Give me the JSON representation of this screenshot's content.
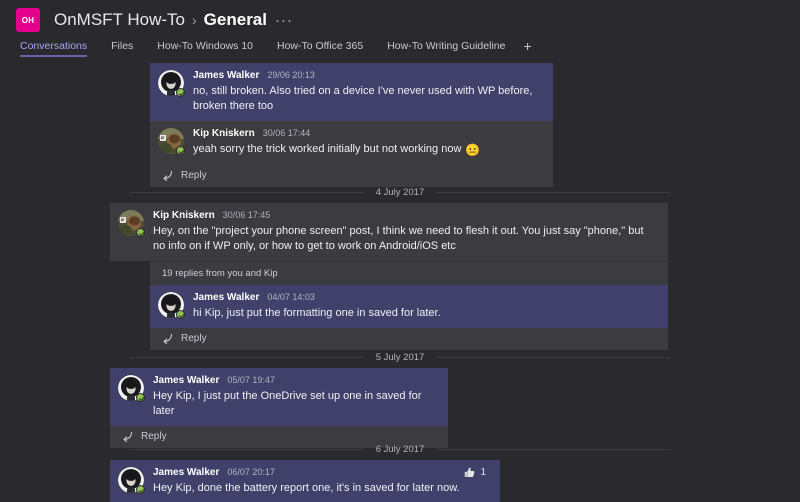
{
  "header": {
    "team_avatar_initials": "OH",
    "team_name": "OnMSFT How-To",
    "separator": "›",
    "channel_name": "General",
    "more_options": "···"
  },
  "tabs": {
    "items": [
      {
        "label": "Conversations",
        "active": true
      },
      {
        "label": "Files",
        "active": false
      },
      {
        "label": "How-To Windows 10",
        "active": false
      },
      {
        "label": "How-To Office 365",
        "active": false
      },
      {
        "label": "How-To Writing Guideline",
        "active": false
      }
    ],
    "add_tab_label": "+"
  },
  "conversation": {
    "reply_label": "Reply",
    "threads": [
      {
        "id": "thread-1",
        "messages": [
          {
            "author": "James Walker",
            "timestamp": "29/06 20:13",
            "text": "no, still broken. Also tried on a device I've never used with WP before, broken there too",
            "style": "highlight",
            "avatar": "james"
          },
          {
            "author": "Kip Kniskern",
            "timestamp": "30/06 17:44",
            "text": "yeah sorry the trick worked initially but not working now",
            "emoji": "😐",
            "style": "plain",
            "avatar": "kip"
          }
        ]
      },
      {
        "id": "thread-2",
        "date_divider": "4 July 2017",
        "root": {
          "author": "Kip Kniskern",
          "timestamp": "30/06 17:45",
          "text": "Hey, on the \"project your phone screen\" post, I think we need  to flesh it out. You just say \"phone,\" but no info on if WP only, or how to get to work on Android/iOS etc",
          "style": "plain",
          "avatar": "kip"
        },
        "replies_summary": "19 replies from you and Kip",
        "messages": [
          {
            "author": "James Walker",
            "timestamp": "04/07 14:03",
            "text": "hi Kip, just put the formatting one in saved for later.",
            "style": "highlight",
            "avatar": "james"
          }
        ]
      },
      {
        "id": "thread-3",
        "date_divider": "5 July 2017",
        "messages": [
          {
            "author": "James Walker",
            "timestamp": "05/07 19:47",
            "text": "Hey Kip, I just put the OneDrive set up one in saved for later",
            "style": "highlight",
            "avatar": "james"
          }
        ]
      },
      {
        "id": "thread-4",
        "date_divider": "6 July 2017",
        "messages": [
          {
            "author": "James Walker",
            "timestamp": "06/07 20:17",
            "text": "Hey Kip, done the battery report one, it's in saved for later now.",
            "style": "highlight",
            "avatar": "james",
            "reaction": {
              "icon": "thumbs-up",
              "count": "1"
            }
          }
        ]
      }
    ]
  },
  "colors": {
    "page_background": "#2a2a2e",
    "accent": "#6264a7",
    "highlight_message": "#40406b",
    "plain_message": "#3b3b40",
    "team_avatar": "#e3008c",
    "presence_available": "#92c353",
    "active_tab_text": "#a6a4f0"
  }
}
